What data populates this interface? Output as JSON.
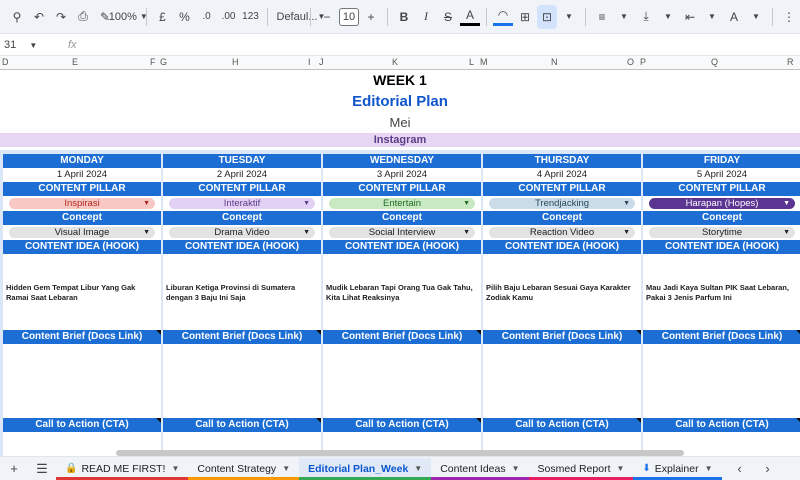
{
  "toolbar": {
    "zoom": "100%",
    "currency": "£",
    "percent": "%",
    "decimal_decrease": ".0",
    "decimal_increase": ".00",
    "number_format": "123",
    "font": "Defaul...",
    "font_size": "10",
    "bold": "B",
    "italic": "I",
    "strikethrough": "S",
    "text_color": "A",
    "text_rotate": "A"
  },
  "formula_bar": {
    "name_box": "31",
    "fx": "fx"
  },
  "columns": [
    "D",
    "E",
    "F",
    "G",
    "H",
    "I",
    "J",
    "K",
    "L",
    "M",
    "N",
    "O",
    "P",
    "Q",
    "R"
  ],
  "sheet": {
    "week": "WEEK 1",
    "plan_title": "Editorial Plan",
    "month": "Mei",
    "platform": "Instagram",
    "labels": {
      "content_pillar": "CONTENT PILLAR",
      "concept": "Concept",
      "content_idea": "CONTENT IDEA (HOOK)",
      "content_brief": "Content Brief (Docs Link)",
      "cta": "Call to Action (CTA)"
    },
    "days": [
      {
        "day": "MONDAY",
        "date": "1 April 2024",
        "pillar": "Inspirasi",
        "concept": "Visual Image",
        "hook": "Hidden Gem Tempat Libur Yang Gak Ramai Saat Lebaran"
      },
      {
        "day": "TUESDAY",
        "date": "2 April 2024",
        "pillar": "Interaktif",
        "concept": "Drama Video",
        "hook": "Liburan Ketiga Provinsi di Sumatera dengan 3 Baju Ini Saja"
      },
      {
        "day": "WEDNESDAY",
        "date": "3 April 2024",
        "pillar": "Entertain",
        "concept": "Social Interview",
        "hook": "Mudik Lebaran Tapi Orang Tua Gak Tahu, Kita Lihat Reaksinya"
      },
      {
        "day": "THURSDAY",
        "date": "4 April 2024",
        "pillar": "Trendjacking",
        "concept": "Reaction Video",
        "hook": "Pilih Baju Lebaran Sesuai Gaya Karakter Zodiak Kamu"
      },
      {
        "day": "FRIDAY",
        "date": "5 April 2024",
        "pillar": "Harapan (Hopes)",
        "concept": "Storytime",
        "hook": "Mau Jadi Kaya Sultan PIK Saat Lebaran, Pakai 3 Jenis Parfum Ini"
      }
    ],
    "pillar_colors": {
      "Inspirasi": {
        "bg": "#f8c9c4",
        "fg": "#b3261e"
      },
      "Interaktif": {
        "bg": "#e3d0f5",
        "fg": "#5b3c87"
      },
      "Entertain": {
        "bg": "#c9e9c2",
        "fg": "#1e6b24"
      },
      "Trendjacking": {
        "bg": "#c9dce8",
        "fg": "#2b4a5e"
      },
      "Harapan (Hopes)": {
        "bg": "#5b3591",
        "fg": "#ffffff"
      }
    },
    "concept_chip_color": "#e3e3e3",
    "header_color": "#1c6ed4"
  },
  "tabs": [
    {
      "label": "READ ME FIRST!",
      "color": "#e03636",
      "active": false,
      "lock": true
    },
    {
      "label": "Content Strategy",
      "color": "#ff9900",
      "active": false
    },
    {
      "label": "Editorial Plan_Week",
      "color": "#34a853",
      "active": true
    },
    {
      "label": "Content Ideas",
      "color": "#9c27b0",
      "active": false
    },
    {
      "label": "Sosmed Report",
      "color": "#e91e63",
      "active": false
    },
    {
      "label": "Explainer",
      "color": "#1a73e8",
      "active": false,
      "icon": true
    }
  ]
}
